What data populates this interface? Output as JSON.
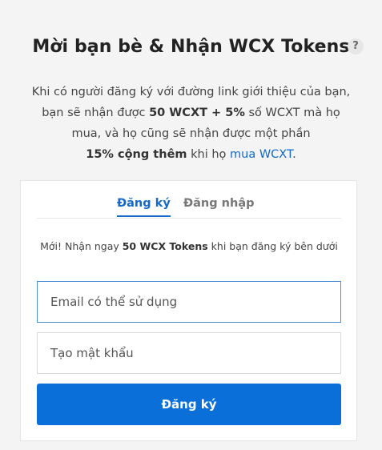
{
  "header": {
    "title": "Mời bạn bè & Nhận WCX Tokens",
    "help_glyph": "?"
  },
  "intro": {
    "part1": "Khi có người đăng ký với đường link giới thiệu của bạn, bạn sẽ nhận được ",
    "bold1": "50 WCXT + 5%",
    "part2": " số WCXT mà họ mua, và họ cũng sẽ nhận được một phần ",
    "bold2": "15% cộng thêm",
    "part3": " khi họ ",
    "link": "mua WCXT",
    "part4": "."
  },
  "tabs": {
    "signup": "Đăng ký",
    "login": "Đăng nhập"
  },
  "promo": {
    "part1": "Mới! Nhận ngay ",
    "bold": "50 WCX Tokens",
    "part2": " khi bạn đăng ký bên dưới"
  },
  "form": {
    "email_placeholder": "Email có thể sử dụng",
    "password_placeholder": "Tạo mật khẩu",
    "submit_label": "Đăng ký"
  },
  "colors": {
    "accent": "#1569c7",
    "button": "#0a6fd8",
    "background": "#f4f4f4"
  },
  "icons": {
    "help": "question-mark-icon"
  }
}
